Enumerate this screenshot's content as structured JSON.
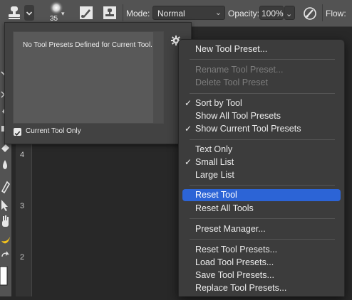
{
  "options_bar": {
    "brush_size": "35",
    "mode_label": "Mode:",
    "mode_value": "Normal",
    "opacity_label": "Opacity:",
    "opacity_value": "100%",
    "flow_label": "Flow:",
    "icons": [
      "stamp-tool-icon",
      "chevron-down-icon",
      "brush-preset-icon",
      "toggle-brush-panel-icon",
      "toggle-clone-source-icon",
      "pressure-opacity-icon"
    ]
  },
  "ruler": {
    "marks": [
      "4",
      "3",
      "2"
    ]
  },
  "preset_panel": {
    "empty_message": "No Tool Presets Defined for Current Tool.",
    "current_tool_only_label": "Current Tool Only",
    "current_tool_only_checked": true
  },
  "menu": {
    "items": [
      {
        "label": "New Tool Preset...",
        "checked": false,
        "enabled": true
      },
      {
        "label": "Rename Tool Preset...",
        "checked": false,
        "enabled": false
      },
      {
        "label": "Delete Tool Preset",
        "checked": false,
        "enabled": false
      },
      {
        "label": "Sort by Tool",
        "checked": true,
        "enabled": true
      },
      {
        "label": "Show All Tool Presets",
        "checked": false,
        "enabled": true
      },
      {
        "label": "Show Current Tool Presets",
        "checked": true,
        "enabled": true
      },
      {
        "label": "Text Only",
        "checked": false,
        "enabled": true
      },
      {
        "label": "Small List",
        "checked": true,
        "enabled": true
      },
      {
        "label": "Large List",
        "checked": false,
        "enabled": true
      },
      {
        "label": "Reset Tool",
        "checked": false,
        "enabled": true,
        "highlighted": true
      },
      {
        "label": "Reset All Tools",
        "checked": false,
        "enabled": true
      },
      {
        "label": "Preset Manager...",
        "checked": false,
        "enabled": true
      },
      {
        "label": "Reset Tool Presets...",
        "checked": false,
        "enabled": true
      },
      {
        "label": "Load Tool Presets...",
        "checked": false,
        "enabled": true
      },
      {
        "label": "Save Tool Presets...",
        "checked": false,
        "enabled": true
      },
      {
        "label": "Replace Tool Presets...",
        "checked": false,
        "enabled": true
      }
    ],
    "checkmark": "✓",
    "highlight_color": "#2c64d6"
  }
}
